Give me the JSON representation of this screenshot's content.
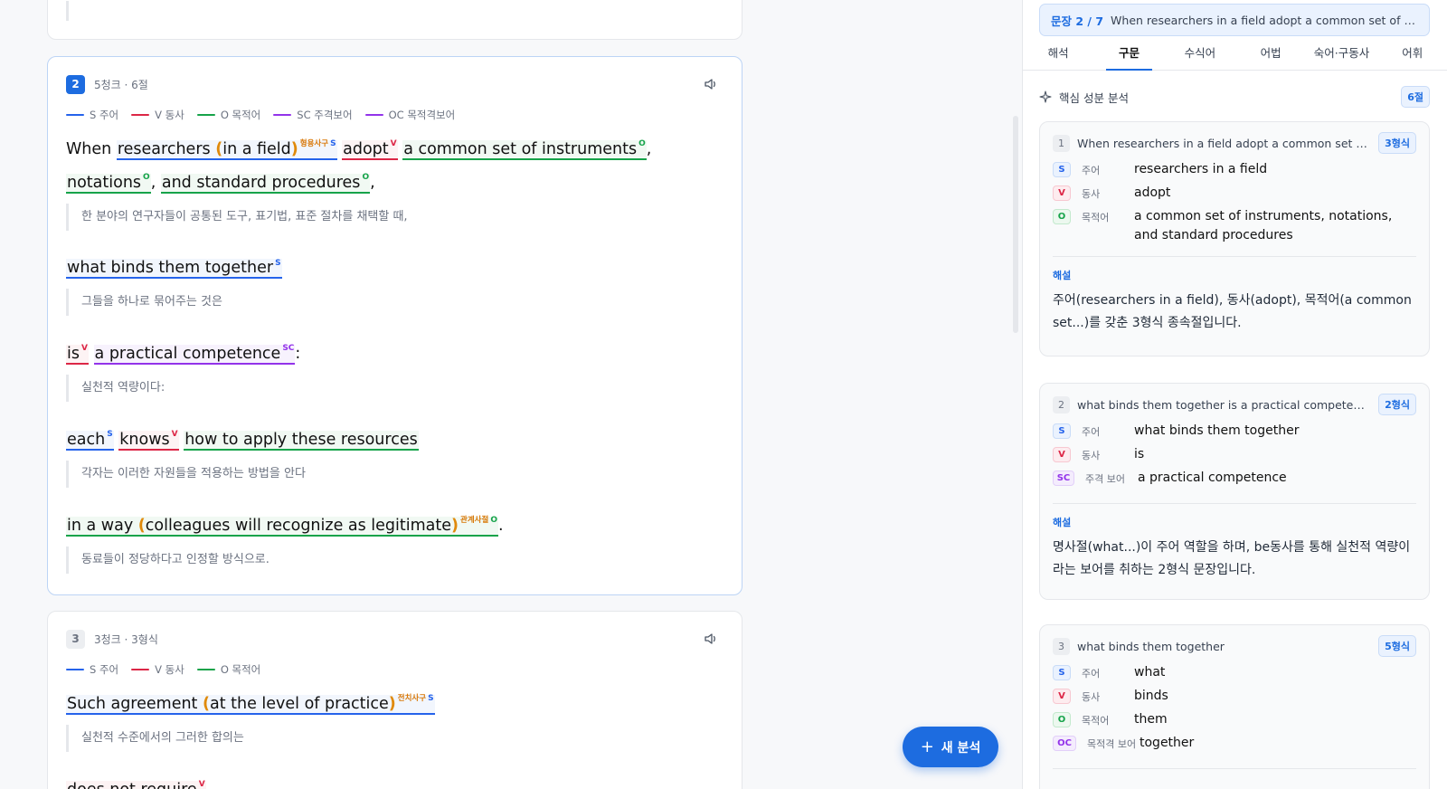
{
  "left": {
    "card2": {
      "number": "2",
      "meta": "5청크 · 6절",
      "legend": [
        {
          "label": "S 주어",
          "color": "#2563eb"
        },
        {
          "label": "V 동사",
          "color": "#dc2646"
        },
        {
          "label": "O 목적어",
          "color": "#16a34a"
        },
        {
          "label": "SC 주격보어",
          "color": "#9333ea"
        },
        {
          "label": "OC 목적격보어",
          "color": "#9333ea"
        }
      ],
      "chunks": {
        "c1": {
          "when": "When",
          "subj": "researchers ",
          "open": "(",
          "mod": "in a field",
          "close": ")",
          "mod_tag": "형용사구",
          "subj_tag": "S",
          "verb": "adopt",
          "verb_tag": "V",
          "obj1": "a common set of instruments",
          "obj_tag": "O",
          "obj2": "notations",
          "obj3": "and standard procedures",
          "comma": ",",
          "translation": "한 분야의 연구자들이 공통된 도구, 표기법, 표준 절차를 채택할 때,"
        },
        "c2": {
          "subj": "what binds them together",
          "subj_tag": "S",
          "translation": "그들을 하나로 묶어주는 것은"
        },
        "c3": {
          "verb": "is",
          "verb_tag": "V",
          "comp": "a practical competence",
          "comp_tag": "SC",
          "colon": ":",
          "translation": "실천적 역량이다:"
        },
        "c4": {
          "subj": "each",
          "subj_tag": "S",
          "verb": "knows",
          "verb_tag": "V",
          "obj": "how to apply these resources",
          "translation": "각자는 이러한 자원들을 적용하는 방법을 안다"
        },
        "c5": {
          "obj_pre": "in a way ",
          "open": "(",
          "mod": "colleagues will recognize as legitimate",
          "close": ")",
          "mod_tag": "관계사절",
          "obj_tag": "O",
          "period": ".",
          "translation": "동료들이 정당하다고 인정할 방식으로."
        }
      }
    },
    "card3": {
      "number": "3",
      "meta": "3청크 · 3형식",
      "legend": [
        {
          "label": "S 주어",
          "color": "#2563eb"
        },
        {
          "label": "V 동사",
          "color": "#dc2646"
        },
        {
          "label": "O 목적어",
          "color": "#16a34a"
        }
      ],
      "chunks": {
        "c1": {
          "subj": "Such agreement ",
          "open": "(",
          "mod": "at the level of practice",
          "close": ")",
          "mod_tag": "전치사구",
          "subj_tag": "S",
          "translation": "실천적 수준에서의 그러한 합의는"
        },
        "c2": {
          "verb": "does not require",
          "verb_tag": "V"
        }
      }
    },
    "fab": {
      "label": "새 분석",
      "icon": "plus-icon"
    }
  },
  "right": {
    "sentence_bar": {
      "index": "문장 2 / 7",
      "text": "When researchers in a field adopt a common set of instruments, notations, and standard procedures"
    },
    "tabs": [
      "해석",
      "구문",
      "수식어",
      "어법",
      "숙어·구동사",
      "어휘"
    ],
    "active_tab": "구문",
    "section": {
      "title": "핵심 성분 분석",
      "badge": "6절"
    },
    "analyses": [
      {
        "n": "1",
        "title": "When researchers in a field adopt a common set of instruments, notations, and standard procedures",
        "form": "3형식",
        "rows": [
          {
            "chip": "S",
            "label": "주어",
            "value": "researchers in a field"
          },
          {
            "chip": "V",
            "label": "동사",
            "value": "adopt"
          },
          {
            "chip": "O",
            "label": "목적어",
            "value": "a common set of instruments, notations, and standard procedures"
          }
        ],
        "ex_label": "해설",
        "explanation": "주어(researchers in a field), 동사(adopt), 목적어(a common set...)를 갖춘 3형식 종속절입니다."
      },
      {
        "n": "2",
        "title": "what binds them together is a practical competence",
        "form": "2형식",
        "rows": [
          {
            "chip": "S",
            "label": "주어",
            "value": "what binds them together"
          },
          {
            "chip": "V",
            "label": "동사",
            "value": "is"
          },
          {
            "chip": "SC",
            "label": "주격 보어",
            "value": "a practical competence"
          }
        ],
        "ex_label": "해설",
        "explanation": "명사절(what...)이 주어 역할을 하며, be동사를 통해 실천적 역량이라는 보어를 취하는 2형식 문장입니다."
      },
      {
        "n": "3",
        "title": "what binds them together",
        "form": "5형식",
        "rows": [
          {
            "chip": "S",
            "label": "주어",
            "value": "what"
          },
          {
            "chip": "V",
            "label": "동사",
            "value": "binds"
          },
          {
            "chip": "O",
            "label": "목적어",
            "value": "them"
          },
          {
            "chip": "OC",
            "label": "목적격 보어",
            "value": "together"
          }
        ]
      }
    ]
  }
}
